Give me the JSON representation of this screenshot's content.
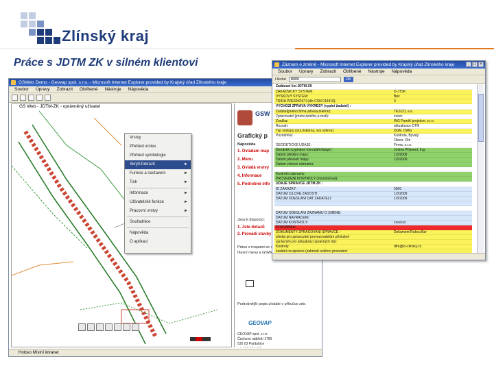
{
  "brand": {
    "name": "Zlínský kraj",
    "colors": {
      "dark": "#1f3c7a",
      "mid": "#7a93c4",
      "light": "#c2cde3",
      "accent": "#e07a1f"
    }
  },
  "slide": {
    "title": "Práce s  JDTM ZK v silném klientovi"
  },
  "window_back": {
    "title": "GSWeb Demo - Geovap spol. s r.o. - Microsoft Internet Explorer provided by Krajský úřad Zlínského kraje",
    "menu": [
      "Soubor",
      "Úpravy",
      "Zobrazit",
      "Oblíbené",
      "Nástroje",
      "Nápověda"
    ],
    "map_title": "GS Web - JDTM-ZK - oprávněný uživatel",
    "context_menu": [
      {
        "label": "Vrstvy",
        "highlight": false,
        "sub": false
      },
      {
        "label": "Přehled vrstev",
        "highlight": false,
        "sub": false
      },
      {
        "label": "Přehled symbologie",
        "highlight": false,
        "sub": false
      },
      {
        "label": "Skrýt/Zobrazit",
        "highlight": true,
        "sub": true
      },
      {
        "label": "Funkce a nastavení",
        "highlight": false,
        "sub": true
      },
      {
        "label": "Tisk",
        "highlight": false,
        "sub": true
      },
      {
        "sep": true
      },
      {
        "label": "Informace",
        "highlight": false,
        "sub": true
      },
      {
        "label": "Uživatelské funkce",
        "highlight": false,
        "sub": true
      },
      {
        "label": "Pracovní vrstvy",
        "highlight": false,
        "sub": true
      },
      {
        "sep": true
      },
      {
        "label": "Souřadnice",
        "highlight": false,
        "sub": false
      },
      {
        "sep": true
      },
      {
        "label": "Nápověda",
        "highlight": false,
        "sub": false
      },
      {
        "label": "O aplikaci",
        "highlight": false,
        "sub": false
      }
    ],
    "panel": {
      "name": "GSW",
      "heading": "Grafický p",
      "subheading": "Nápověda",
      "links": [
        "1. Ovládání map",
        "2. Menu",
        "3. Ovládá vrstvy",
        "4. Informace",
        "5. Podrobné info"
      ],
      "text1": "Jsou k dispozici:",
      "links2": [
        "1. Jste dotazů",
        "2. Provádí stavby"
      ],
      "text2": "Práce s mapami se v GSWeb, kde aplikace hlavní menu a GSWeb",
      "note": "Podrobnější popis získáte v příručce zde.",
      "company": "GEOVAP",
      "address": "GEOVAP spol. s r.o.\nČechovo nábřeží 1790\n530 03 Pardubice\ntel: 466 024 111\nhttp://www.geovap.cz"
    },
    "status": "Hotovo  Místní intranet"
  },
  "window_front": {
    "title": "Záznam o změně - Microsoft Internet Explorer provided by Krajský úřad Zlínského kraje",
    "menu": [
      "Soubor",
      "Úpravy",
      "Zobrazit",
      "Oblíbené",
      "Nástroje",
      "Nápověda"
    ],
    "search_label": "Hledat",
    "search_value": "8000",
    "go": "OK",
    "form_title": "Zadávací list JDTM ZK",
    "rows": [
      {
        "k": "ZÁKAZNICKÝ SYSTÉM:",
        "v": "D-JTSK",
        "c": "yellow"
      },
      {
        "k": "VÝŠKOVÝ SYSTÉM:",
        "v": "Bpv",
        "c": "yellow"
      },
      {
        "k": "TŘÍDA PŘESNOSTI (dle ČSN 013410):",
        "v": "3",
        "c": "yellow"
      },
      {
        "k": "VÝCHOZÍ ZPRÁVA VÝKRESY (vyplní žadatel) :",
        "v": "",
        "c": "white",
        "hdr": true
      },
      {
        "k": "Žadatel(jméno,firma,adresa,telefon):",
        "v": "TESCO, a.s.",
        "c": "yellow"
      },
      {
        "k": "Zpracovatel (jméno,telefon,e-mail):",
        "v": "xxxxx",
        "c": "white"
      },
      {
        "k": "Značka:",
        "v": "ING Paměť projekce, s.r.o.",
        "c": "yellow"
      },
      {
        "k": "Rozsah:",
        "v": "aktualizace DTM",
        "c": "white"
      },
      {
        "k": "Typ výstupu (xxx.tiskárna, xxx.výkres):",
        "v": "DGN, DWG",
        "c": "yellow"
      },
      {
        "k": "Poznámka:",
        "v": "Kontrola, Bývalý",
        "c": "white"
      },
      {
        "k": "",
        "v": "Okres: Zlín",
        "c": "white"
      },
      {
        "k": "GEODETICKÉ ÚDAJE :",
        "v": "Firma, s.r.o.",
        "c": "white"
      },
      {
        "k": "Geodetik (vyplněné formuláře/údaje) :",
        "v": "Jméno Příjmení, Ing.",
        "c": "green"
      },
      {
        "k": "Datum předání mapy:",
        "v": "1/3/2009",
        "c": "green"
      },
      {
        "k": "Datum převzetí mapy:",
        "v": "1/3/2009",
        "c": "green"
      },
      {
        "k": "Datum vrácení záznamu:",
        "v": "",
        "c": "green"
      },
      {
        "k": "",
        "v": "",
        "c": "white"
      },
      {
        "k": "Kontrolní záznamy:",
        "v": "",
        "c": "green"
      },
      {
        "k": "PROVEDENÍ KONTROLY (zkontroloval):",
        "v": "",
        "c": "green"
      },
      {
        "k": "ÚDAJE SPRÁVCE JDTM ZK :",
        "v": "",
        "c": "white",
        "hdr": true
      },
      {
        "k": "ID ZAKÁZKY:",
        "v": "5000",
        "c": "blue"
      },
      {
        "k": "DATUM CÍLOVÉ ŽÁDOSTI:",
        "v": "1/3/2009",
        "c": "blue"
      },
      {
        "k": "DATUM ODESLÁNÍ DAT ŽADATELI:",
        "v": "1/3/2009",
        "c": "blue"
      },
      {
        "k": "",
        "v": "",
        "c": "blue"
      },
      {
        "k": "",
        "v": "",
        "c": "white"
      },
      {
        "k": "DATUM ODESLÁNÍ ZÁZNAMU O ZMĚNĚ:",
        "v": "",
        "c": "blue"
      },
      {
        "k": "DATUM NAVRÁCENÍ:",
        "v": "",
        "c": "blue"
      },
      {
        "k": "DATUM KONTROLY:",
        "v": "xxxxxxx",
        "c": "blue"
      },
      {
        "k": "POZNÁMKA:",
        "v": "",
        "c": "red"
      },
      {
        "k": "DOKUMENTY ZPRACOVÁNÍ SPRÁVCE :",
        "v": "Dokument Rukou Bar",
        "c": "yellow"
      },
      {
        "k": "předat pro zpracování provozovatelům příslušné",
        "v": "",
        "c": "yellow"
      },
      {
        "k": "správcům pro aktualizaci správných dat:",
        "v": "",
        "c": "yellow"
      },
      {
        "k": "Kontroly:",
        "v": "dtm@kr-zlinsky.cz",
        "c": "yellow"
      },
      {
        "k": "zaslání na správce (zahrnutí ověření provedení",
        "v": "",
        "c": "yellow"
      },
      {
        "k": "kontroly):",
        "v": "tel: 577043741",
        "c": "yellow"
      }
    ]
  }
}
